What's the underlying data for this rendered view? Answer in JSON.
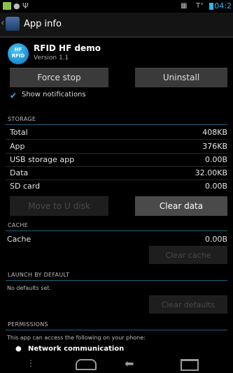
{
  "status_bar": {
    "time": "04:2"
  },
  "action_bar": {
    "back_glyph": "‹",
    "title": "App info"
  },
  "app": {
    "icon_text_top": "HF",
    "icon_text_bottom": "RFID",
    "name": "RFID HF demo",
    "version": "Version 1.1"
  },
  "buttons": {
    "force_stop": "Force stop",
    "uninstall": "Uninstall",
    "move_to_udisk": "Move to U disk",
    "clear_data": "Clear data",
    "clear_cache": "Clear cache",
    "clear_defaults": "Clear defaults"
  },
  "show_notifications": {
    "label": "Show notifications",
    "checked": true
  },
  "storage": {
    "header": "STORAGE",
    "rows": [
      {
        "label": "Total",
        "value": "408KB"
      },
      {
        "label": "App",
        "value": "376KB"
      },
      {
        "label": "USB storage app",
        "value": "0.00B"
      },
      {
        "label": "Data",
        "value": "32.00KB"
      },
      {
        "label": "SD card",
        "value": "0.00B"
      }
    ]
  },
  "cache": {
    "header": "CACHE",
    "label": "Cache",
    "value": "0.00B"
  },
  "launch": {
    "header": "LAUNCH BY DEFAULT",
    "text": "No defaults set."
  },
  "permissions": {
    "header": "PERMISSIONS",
    "intro": "This app can access the following on your phone:",
    "items": [
      "Network communication"
    ]
  },
  "colors": {
    "accent": "#33b5e5",
    "background": "#000000",
    "button": "#3a3a3a"
  },
  "icons": [
    "photo-icon",
    "android-icon",
    "usb-icon",
    "sim-icon",
    "signal-icon",
    "battery-icon",
    "back-nav-icon",
    "home-nav-icon",
    "recents-nav-icon",
    "menu-dots-icon"
  ]
}
